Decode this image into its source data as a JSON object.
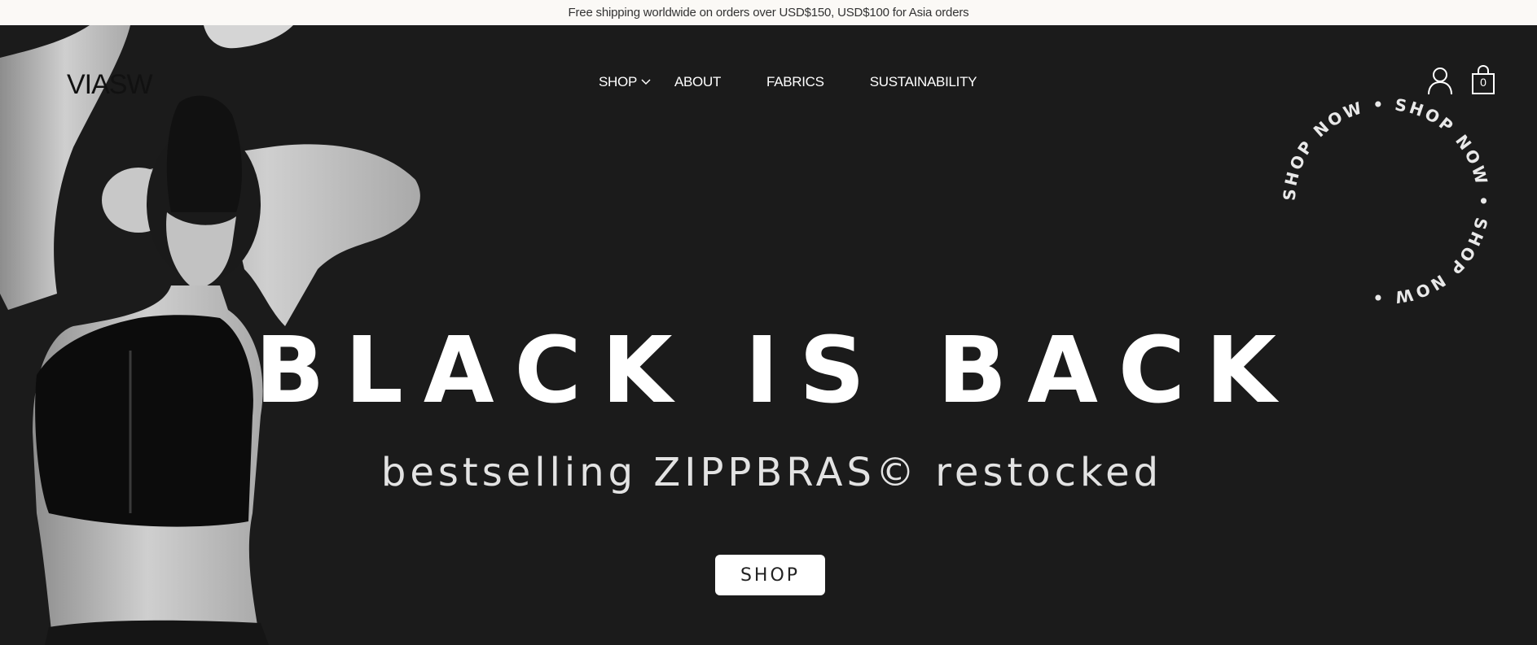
{
  "announcement": "Free shipping worldwide on orders over USD$150, USD$100 for Asia orders",
  "brand": {
    "logo_text": "VIASW"
  },
  "nav": {
    "shop": "SHOP",
    "about": "ABOUT",
    "fabrics": "FABRICS",
    "sustainability": "SUSTAINABILITY"
  },
  "header_icons": {
    "account": "user-icon",
    "cart": "shopping-bag-icon",
    "cart_count": "0"
  },
  "badge": {
    "text": "SHOP NOW • SHOP NOW • SHOP NOW • "
  },
  "hero": {
    "headline": "BLACK IS BACK",
    "subheadline": "bestselling ZIPPBRAS© restocked",
    "cta": "SHOP"
  },
  "colors": {
    "background": "#1b1b1b",
    "announcement_bg": "#fbf9f6",
    "text_light": "#ffffff"
  }
}
